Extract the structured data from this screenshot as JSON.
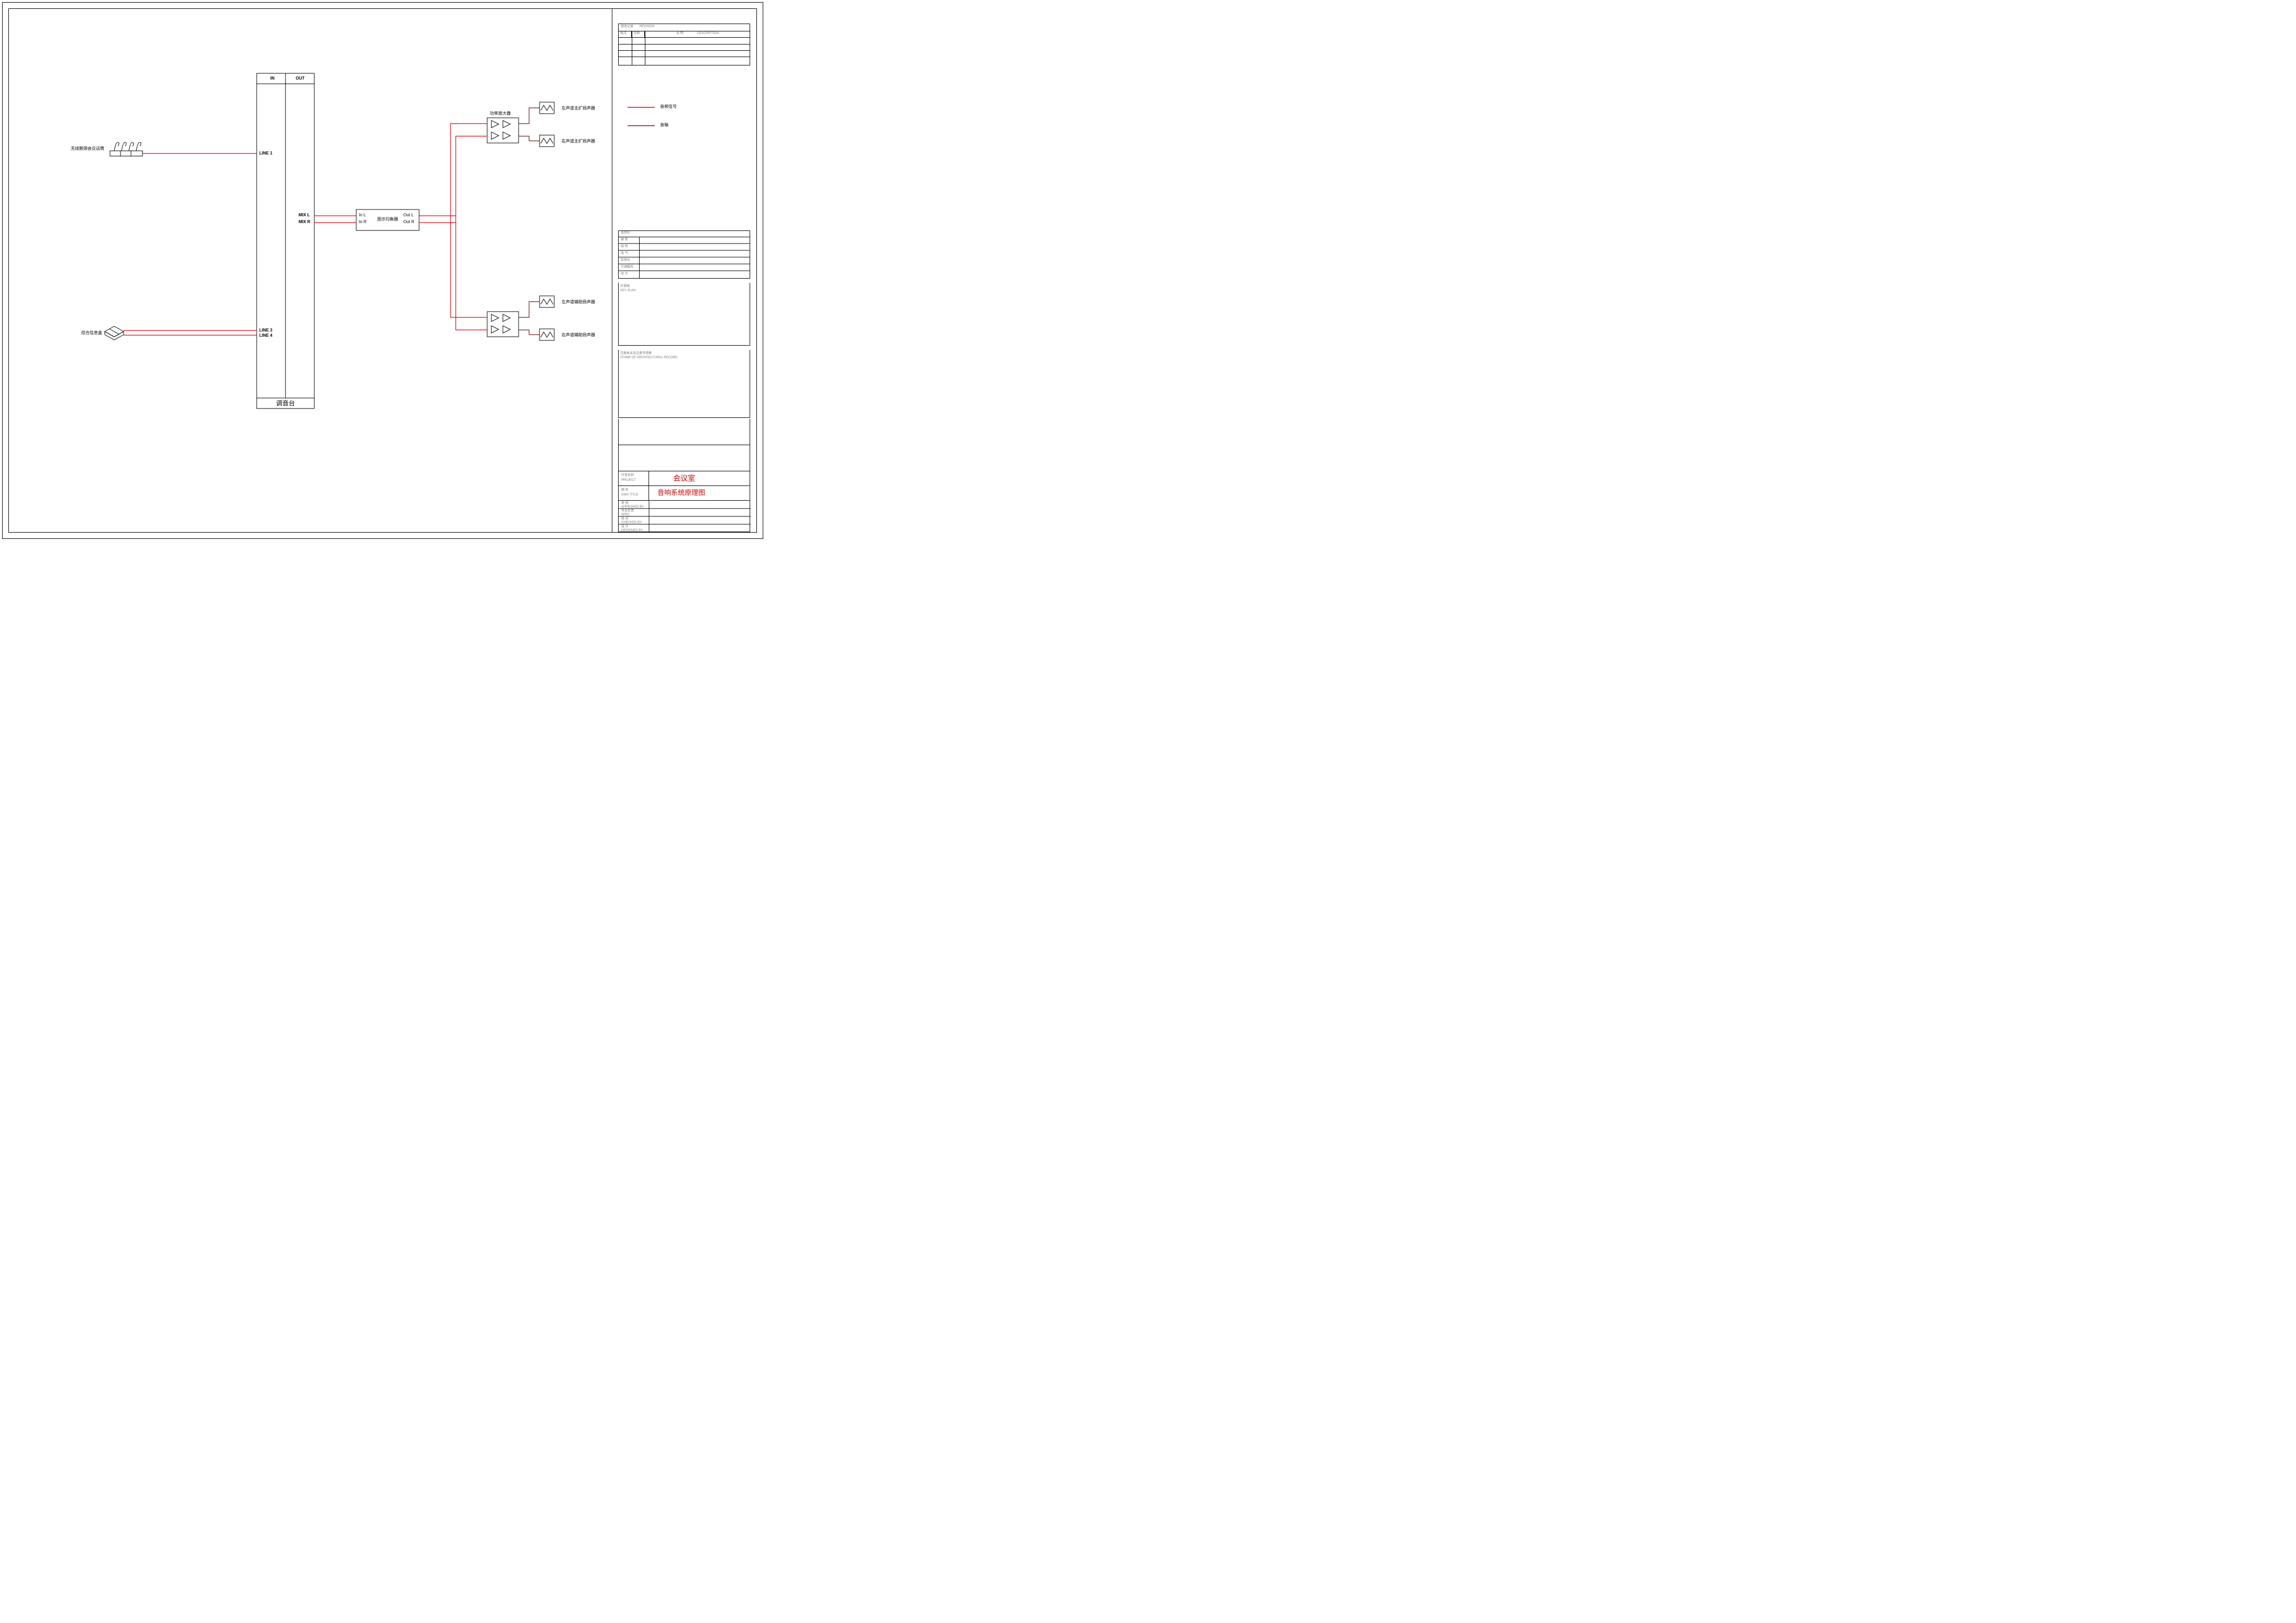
{
  "inputs": {
    "wireless_mic": "无线鹅颈会议话筒",
    "info_box": "综合信息盒"
  },
  "mixer": {
    "name": "调音台",
    "header_in": "IN",
    "header_out": "OUT",
    "ports": {
      "line1": "LINE 1",
      "line3": "LINE 3",
      "line4": "LINE 4",
      "mixl": "MIX L",
      "mixr": "MIX R"
    }
  },
  "eq": {
    "name": "图示均衡器",
    "in_l": "In L",
    "in_r": "In R",
    "out_l": "Out L",
    "out_r": "Out R"
  },
  "amp": {
    "name": "功率放大器"
  },
  "speakers": {
    "main_l": "左声道主扩扬声器",
    "main_r": "右声道主扩扬声器",
    "aux_l": "左声道辅助扬声器",
    "aux_r": "右声道辅助扬声器"
  },
  "legend": {
    "audio_signal": "音频信号",
    "speaker_line": "音箱"
  },
  "titleblock": {
    "top_header": "修改记录",
    "top_header_en": "REVISION",
    "top_cols": {
      "a": "版次",
      "b": "日期",
      "c": "说 明",
      "c_en": "DESCRIPTION"
    },
    "sign_header": "会签栏",
    "sign_rows": [
      "建 筑",
      "结 构",
      "电 气",
      "给排水",
      "空调暖风",
      "动 力"
    ],
    "keyplan": "示意图",
    "keyplan_en": "KEY PLAN",
    "stamp": "注册执业及注册专用章",
    "stamp_en": "STAMP OF ARCHITECTURAL RECORD",
    "project_label": "厅室名称",
    "project_label_en": "PROJECT",
    "project_value": "会议室",
    "dwg_label": "图 名",
    "dwg_label_en": "DWG TITLE",
    "dwg_value": "音响系统原理图",
    "rows": [
      {
        "zh": "审 核",
        "en": "APPROVED BY"
      },
      {
        "zh": "专业负责",
        "en": "SPEC"
      },
      {
        "zh": "校 对",
        "en": "CHECKED BY"
      },
      {
        "zh": "设 计",
        "en": "DESIGNED BY"
      }
    ]
  },
  "colors": {
    "audio": "#e3000f",
    "speaker": "#6b1f1f"
  }
}
